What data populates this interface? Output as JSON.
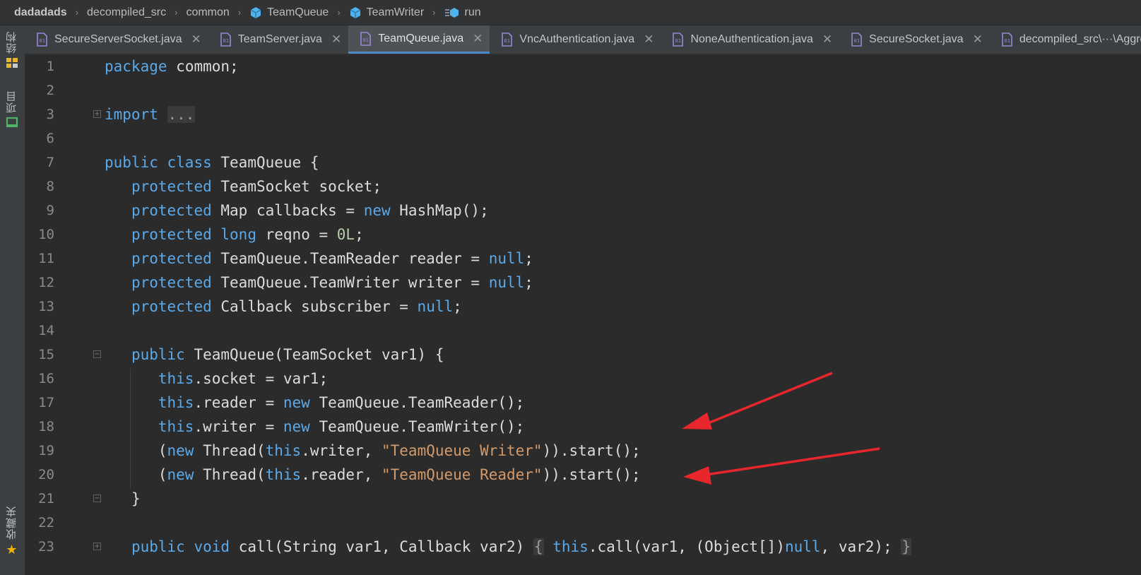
{
  "breadcrumb": {
    "items": [
      "dadadads",
      "decompiled_src",
      "common",
      "TeamQueue",
      "TeamWriter",
      "run"
    ]
  },
  "toolstrip": {
    "structure_label": "结构",
    "project_label": "项目",
    "favorites_label": "收藏夹"
  },
  "tabs": [
    {
      "label": "SecureServerSocket.java",
      "active": false
    },
    {
      "label": "TeamServer.java",
      "active": false
    },
    {
      "label": "TeamQueue.java",
      "active": true
    },
    {
      "label": "VncAuthentication.java",
      "active": false
    },
    {
      "label": "NoneAuthentication.java",
      "active": false
    },
    {
      "label": "SecureSocket.java",
      "active": false
    },
    {
      "label": "decompiled_src\\···\\Aggress",
      "active": false
    }
  ],
  "line_numbers": [
    "1",
    "2",
    "3",
    "6",
    "7",
    "8",
    "9",
    "10",
    "11",
    "12",
    "13",
    "14",
    "15",
    "16",
    "17",
    "18",
    "19",
    "20",
    "21",
    "22",
    "23"
  ],
  "code": {
    "package_kw": "package",
    "package_name": "common;",
    "import_kw": "import",
    "import_fold": "...",
    "class_decl": {
      "public": "public",
      "class": "class",
      "rest": "TeamQueue {"
    },
    "field_socket": {
      "mod": "protected",
      "rest": "TeamSocket socket;"
    },
    "field_callbacks": {
      "mod": "protected",
      "a": "Map callbacks = ",
      "new": "new",
      "b": "HashMap();"
    },
    "field_reqno": {
      "mod": "protected",
      "long": "long",
      "a": "reqno = ",
      "num": "0L",
      "b": ";"
    },
    "field_reader": {
      "mod": "protected",
      "a": "TeamQueue.TeamReader reader = ",
      "null": "null",
      "b": ";"
    },
    "field_writer": {
      "mod": "protected",
      "a": "TeamQueue.TeamWriter writer = ",
      "null": "null",
      "b": ";"
    },
    "field_subscriber": {
      "mod": "protected",
      "a": "Callback subscriber = ",
      "null": "null",
      "b": ";"
    },
    "ctor_decl": {
      "public": "public",
      "rest": "TeamQueue(TeamSocket var1) {"
    },
    "ctor_l1": {
      "this": "this",
      "rest": ".socket = var1;"
    },
    "ctor_l2": {
      "this": "this",
      "a": ".reader = ",
      "new": "new",
      "b": "TeamQueue.TeamReader();"
    },
    "ctor_l3": {
      "this": "this",
      "a": ".writer = ",
      "new": "new",
      "b": "TeamQueue.TeamWriter();"
    },
    "ctor_l4": {
      "open": "(",
      "new": "new",
      "a": "Thread(",
      "this": "this",
      "b": ".writer, ",
      "str": "\"TeamQueue Writer\"",
      "c": ")).start();"
    },
    "ctor_l5": {
      "open": "(",
      "new": "new",
      "a": "Thread(",
      "this": "this",
      "b": ".reader, ",
      "str": "\"TeamQueue Reader\"",
      "c": ")).start();"
    },
    "ctor_close": "}",
    "call_decl": {
      "public": "public",
      "void": "void",
      "a": "call(String var1, Callback var2)",
      "lb": "{",
      "this": "this",
      "b": ".call(var1, (Object[])",
      "null": "null",
      "c": ", var2);",
      "rb": "}"
    }
  },
  "colors": {
    "editor_bg": "#2b2b2b",
    "keyword": "#5aa9ea",
    "string": "#d29a6a",
    "number": "#b5cea8",
    "annotation_arrow": "#e8262c"
  }
}
